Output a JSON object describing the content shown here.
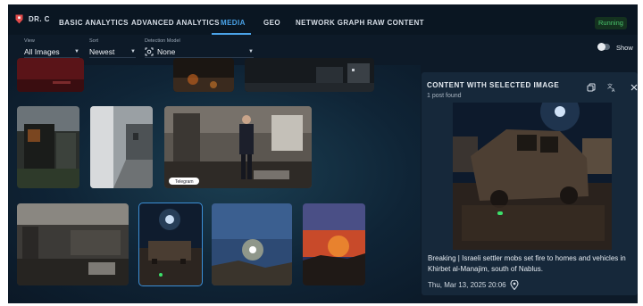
{
  "brand": {
    "label": "DR. C"
  },
  "nav": {
    "items": [
      {
        "label": "BASIC ANALYTICS"
      },
      {
        "label": "ADVANCED ANALYTICS"
      },
      {
        "label": "MEDIA"
      },
      {
        "label": "GEO"
      },
      {
        "label": "NETWORK GRAPH"
      },
      {
        "label": "RAW CONTENT"
      }
    ],
    "active": "MEDIA"
  },
  "status": {
    "label": "Running",
    "color": "#49c26b"
  },
  "filters": {
    "view": {
      "label": "View",
      "value": "All Images"
    },
    "sort": {
      "label": "Sort",
      "value": "Newest"
    },
    "detection": {
      "label": "Detection Model",
      "value": "None",
      "icon": "scan-icon"
    }
  },
  "show_toggle": {
    "label": "Show",
    "on": false
  },
  "gallery": {
    "thumbnails": [
      {
        "name": "thumb-row1-1",
        "scene": "dark-red"
      },
      {
        "name": "thumb-row1-2",
        "scene": "night-fire"
      },
      {
        "name": "thumb-row1-3",
        "scene": "street-night"
      },
      {
        "name": "thumb-row2-1",
        "scene": "burned-balcony"
      },
      {
        "name": "thumb-row2-2",
        "scene": "street-wall"
      },
      {
        "name": "thumb-row2-3",
        "scene": "man-in-burned-room"
      },
      {
        "name": "thumb-row3-1",
        "scene": "burned-interior"
      },
      {
        "name": "thumb-row3-2",
        "scene": "burned-car-night",
        "selected": true
      },
      {
        "name": "thumb-row3-3",
        "scene": "flare-over-rubble"
      },
      {
        "name": "thumb-row3-4",
        "scene": "fire-sky"
      }
    ],
    "watermark": "Telegram"
  },
  "panel": {
    "title": "CONTENT WITH SELECTED IMAGE",
    "count": "1 post found",
    "caption": "Breaking | Israeli settler mobs set fire to homes and vehicles in Khirbet al-Manajim, south of Nablus.",
    "timestamp": "Thu, Mar 13, 2025 20:06",
    "icons": [
      "copy-icon",
      "translate-icon",
      "close-icon",
      "location-pin-icon"
    ]
  }
}
